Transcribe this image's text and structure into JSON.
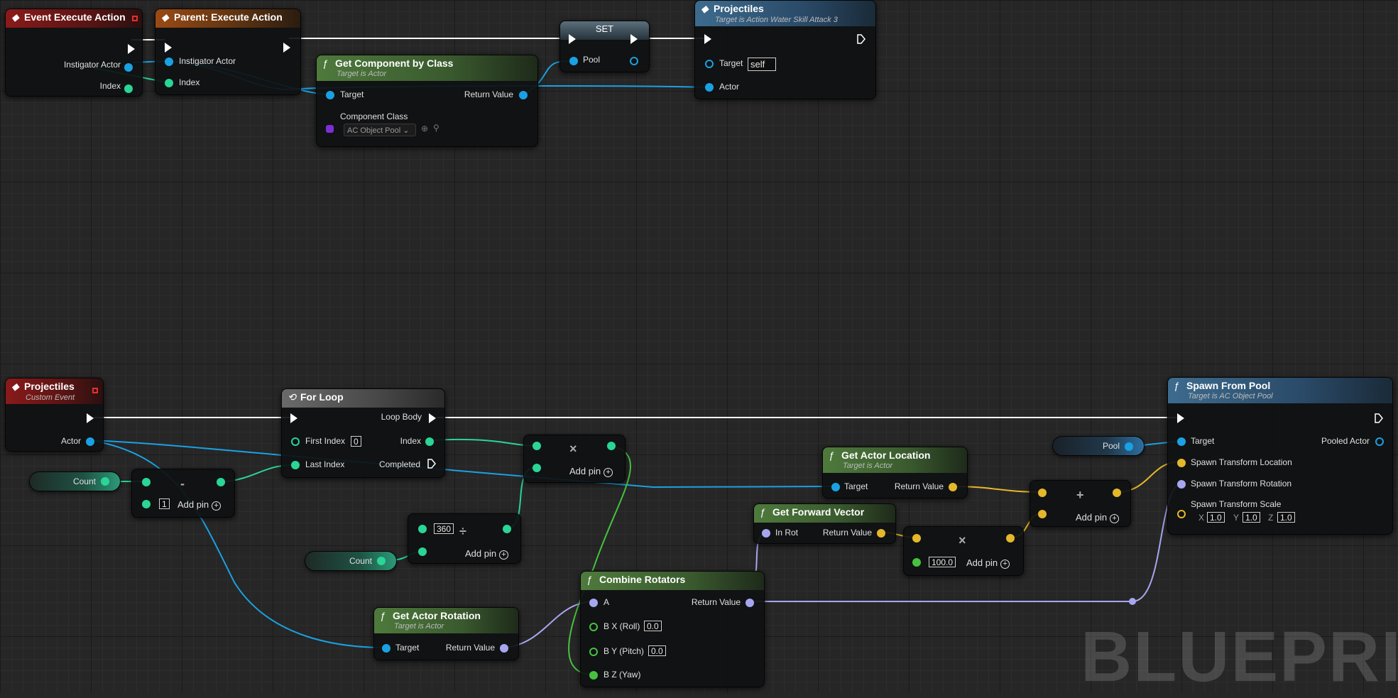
{
  "watermark": "BLUEPRINT",
  "event_execute": {
    "title": "Event Execute Action",
    "pins": [
      "Instigator Actor",
      "Index"
    ]
  },
  "parent_execute": {
    "title": "Parent: Execute Action",
    "pins": [
      "Instigator Actor",
      "Index"
    ]
  },
  "get_component": {
    "title": "Get Component by Class",
    "subtitle": "Target is Actor",
    "target": "Target",
    "return_value": "Return Value",
    "component_class": "Component Class",
    "class_value": "AC Object Pool"
  },
  "set_node": {
    "title": "SET",
    "pin": "Pool"
  },
  "projectiles_call": {
    "title": "Projectiles",
    "subtitle": "Target is Action Water Skill Attack 3",
    "target": "Target",
    "target_value": "self",
    "actor": "Actor"
  },
  "projectiles_event": {
    "title": "Projectiles",
    "subtitle": "Custom Event",
    "actor": "Actor"
  },
  "for_loop": {
    "title": "For Loop",
    "loop_body": "Loop Body",
    "first_index": "First Index",
    "first_index_value": "0",
    "index": "Index",
    "last_index": "Last Index",
    "completed": "Completed"
  },
  "count_var_1": {
    "label": "Count"
  },
  "count_var_2": {
    "label": "Count"
  },
  "subtract": {
    "op": "-",
    "b_value": "1",
    "add_pin": "Add pin"
  },
  "multiply_index": {
    "op": "×",
    "add_pin": "Add pin"
  },
  "divide": {
    "op": "÷",
    "a_value": "360",
    "add_pin": "Add pin"
  },
  "get_actor_location": {
    "title": "Get Actor Location",
    "subtitle": "Target is Actor",
    "target": "Target",
    "return_value": "Return Value"
  },
  "get_forward_vector": {
    "title": "Get Forward Vector",
    "in_rot": "In Rot",
    "return_value": "Return Value"
  },
  "multiply_vector": {
    "op": "×",
    "b_value": "100.0",
    "add_pin": "Add pin"
  },
  "add_vector": {
    "op": "+",
    "add_pin": "Add pin"
  },
  "combine_rotators": {
    "title": "Combine Rotators",
    "a": "A",
    "return_value": "Return Value",
    "bx": "B X (Roll)",
    "bx_value": "0.0",
    "by": "B Y (Pitch)",
    "by_value": "0.0",
    "bz": "B Z (Yaw)"
  },
  "get_actor_rotation": {
    "title": "Get Actor Rotation",
    "subtitle": "Target is Actor",
    "target": "Target",
    "return_value": "Return Value"
  },
  "pool_var": {
    "label": "Pool"
  },
  "spawn_from_pool": {
    "title": "Spawn From Pool",
    "subtitle": "Target is AC Object Pool",
    "target": "Target",
    "pooled_actor": "Pooled Actor",
    "location": "Spawn Transform Location",
    "rotation": "Spawn Transform Rotation",
    "scale": "Spawn Transform Scale",
    "x_label": "X",
    "x_value": "1.0",
    "y_label": "Y",
    "y_value": "1.0",
    "z_label": "Z",
    "z_value": "1.0"
  },
  "colors": {
    "exec": "#ffffff",
    "object": "#1aa1e3",
    "integer": "#2ad596",
    "float": "#47c23f",
    "vector": "#e5b72a",
    "rotator": "#a6a6f0",
    "class": "#7b2fd6"
  }
}
